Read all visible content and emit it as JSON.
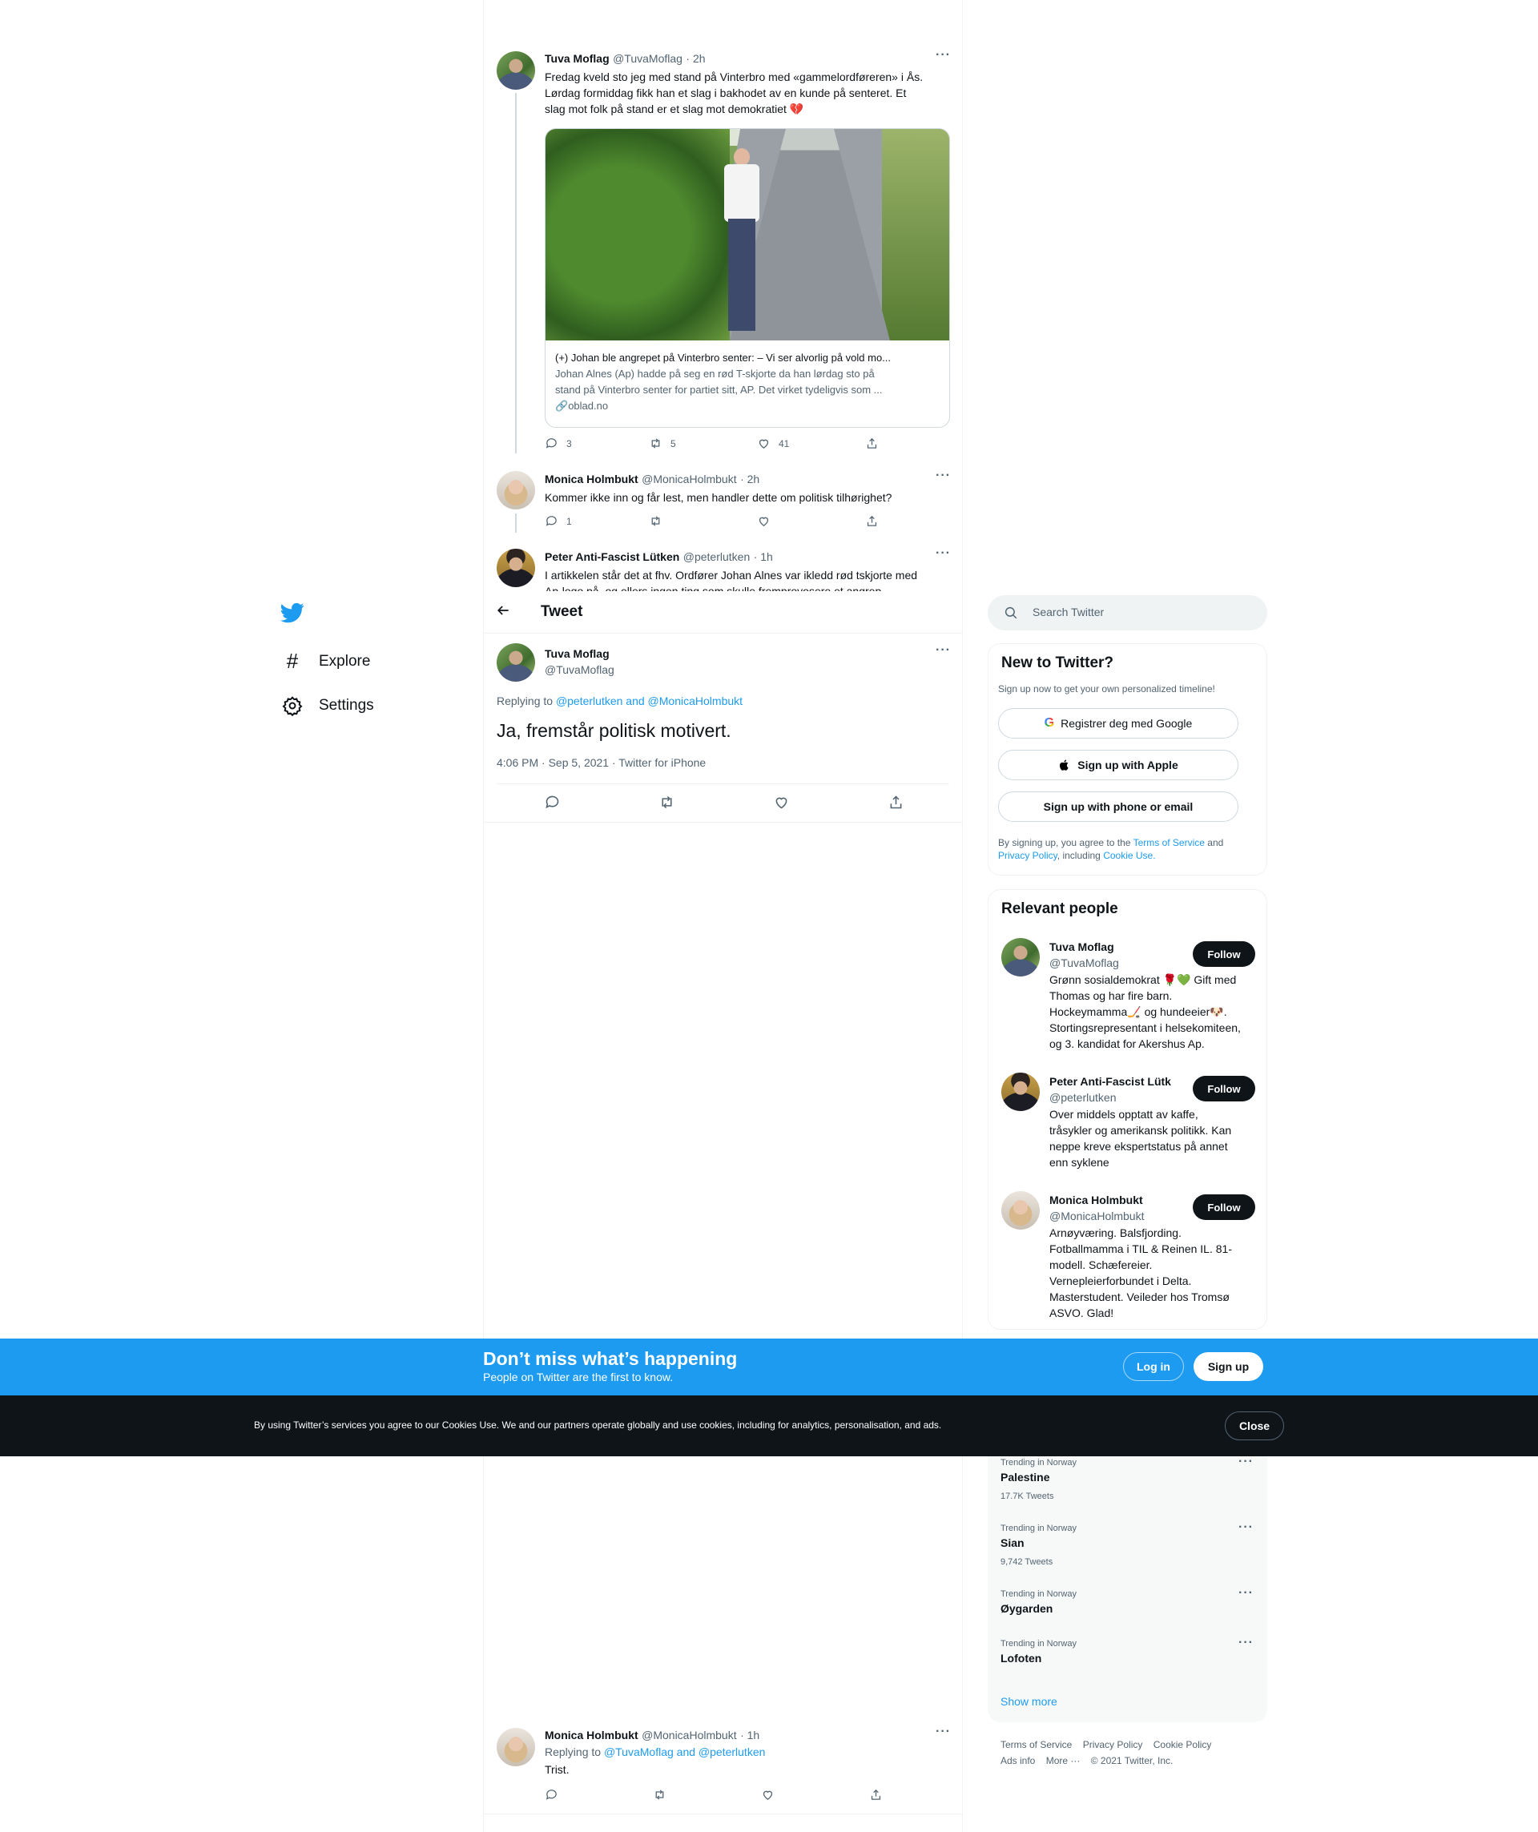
{
  "thread": {
    "tweet1": {
      "name": "Tuva Moflag",
      "handle": "@TuvaMoflag",
      "time": "· 2h",
      "text_line1": "Fredag kveld sto jeg med stand på Vinterbro med «gammelordføreren» i Ås.",
      "text_line2": "Lørdag formiddag fikk han et slag i bakhodet av en kunde på senteret. Et",
      "text_line3": "slag mot folk på stand er et slag mot demokratiet 💔",
      "card_title": "(+) Johan ble angrepet på Vinterbro senter: – Vi ser alvorlig på vold mo...",
      "card_desc_line1": "Johan Alnes (Ap) hadde på seg en rød T-skjorte da han lørdag sto på",
      "card_desc_line2": "stand på Vinterbro senter for partiet sitt, AP. Det virket tydeligvis som ...",
      "card_domain": "oblad.no",
      "replies": "3",
      "retweets": "5",
      "likes": "41"
    },
    "tweet2": {
      "name": "Monica Holmbukt",
      "handle": "@MonicaHolmbukt",
      "time": "· 2h",
      "text": "Kommer ikke inn og får lest, men handler dette om politisk tilhørighet?",
      "replies": "1"
    },
    "tweet3": {
      "name": "Peter Anti-Fascist Lütken",
      "handle": "@peterlutken",
      "time": "· 1h",
      "text_line1": "I artikkelen står det at fhv. Ordfører Johan Alnes var ikledd rød tskjorte med",
      "text_line2": "Ap-logo på, og ellers ingen ting som skulle fremprovosere et angrep."
    }
  },
  "header": {
    "title": "Tweet"
  },
  "main_tweet": {
    "name": "Tuva Moflag",
    "handle": "@TuvaMoflag",
    "replying_prefix": "Replying to",
    "replying_to": "@peterlutken and @MonicaHolmbukt",
    "text": "Ja, fremstår politisk motivert.",
    "timestamp": "4:06 PM · Sep 5, 2021 · Twitter for iPhone"
  },
  "bottom_reply": {
    "name": "Monica Holmbukt",
    "handle": "@MonicaHolmbukt",
    "time": "· 1h",
    "replying_prefix": "Replying to",
    "replying_to": "@TuvaMoflag and @peterlutken",
    "text": "Trist."
  },
  "nav": {
    "explore": "Explore",
    "settings": "Settings"
  },
  "search": {
    "placeholder": "Search Twitter"
  },
  "new_to_twitter": {
    "title": "New to Twitter?",
    "subtitle": "Sign up now to get your own personalized timeline!",
    "google": "Registrer deg med Google",
    "apple": "Sign up with Apple",
    "phone": "Sign up with phone or email",
    "legal_prefix": "By signing up, you agree to the",
    "terms": "Terms of Service",
    "and": "and",
    "privacy": "Privacy Policy",
    "including": ", including",
    "cookie": "Cookie Use."
  },
  "relevant_people": {
    "title": "Relevant people",
    "follow_label": "Follow",
    "people": [
      {
        "name": "Tuva Moflag",
        "handle": "@TuvaMoflag",
        "bio1": "Grønn sosialdemokrat 🌹💚 Gift med",
        "bio2": "Thomas og har fire barn.",
        "bio3": "Hockeymamma🏒 og hundeeier🐶.",
        "bio4": "Stortingsrepresentant i helsekomiteen,",
        "bio5": "og 3. kandidat for Akershus Ap."
      },
      {
        "name": "Peter Anti-Fascist Lütk",
        "handle": "@peterlutken",
        "bio1": "Over middels opptatt av kaffe,",
        "bio2": "tråsykler og amerikansk politikk. Kan",
        "bio3": "neppe kreve ekspertstatus på annet",
        "bio4": "enn syklene"
      },
      {
        "name": "Monica Holmbukt",
        "handle": "@MonicaHolmbukt",
        "bio1": "Arnøyværing. Balsfjording.",
        "bio2": "Fotballmamma i TIL & Reinen IL. 81-",
        "bio3": "modell. Schæfereier.",
        "bio4": "Vernepleierforbundet i Delta.",
        "bio5": "Masterstudent. Veileder hos Tromsø",
        "bio6": "ASVO. Glad!"
      }
    ]
  },
  "trends": {
    "items": [
      {
        "context": "Trending in Norway",
        "name": "Palestine",
        "count": "17.7K Tweets"
      },
      {
        "context": "Trending in Norway",
        "name": "Sian",
        "count": "9,742 Tweets"
      },
      {
        "context": "Trending in Norway",
        "name": "Øygarden",
        "count": ""
      },
      {
        "context": "Trending in Norway",
        "name": "Lofoten",
        "count": ""
      }
    ],
    "show_more": "Show more"
  },
  "footer": {
    "terms": "Terms of Service",
    "privacy": "Privacy Policy",
    "cookie": "Cookie Policy",
    "ads": "Ads info",
    "more": "More ···",
    "copyright": "© 2021 Twitter, Inc."
  },
  "signup_bar": {
    "title": "Don’t miss what’s happening",
    "subtitle": "People on Twitter are the first to know.",
    "login": "Log in",
    "signup": "Sign up"
  },
  "cookie_bar": {
    "text": "By using Twitter’s services you agree to our Cookies Use. We and our partners operate globally and use cookies, including for analytics, personalisation, and ads.",
    "close": "Close"
  },
  "colors": {
    "accent": "#1d9bf0",
    "text": "#0f1419",
    "muted": "#536471",
    "border": "#eff3f4"
  }
}
